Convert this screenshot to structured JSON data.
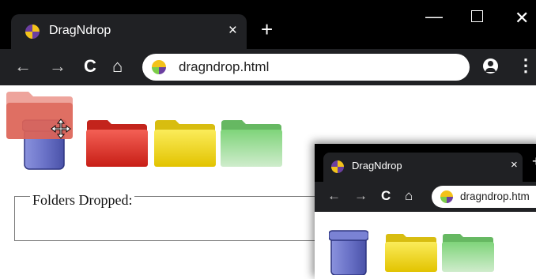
{
  "main_window": {
    "tab_title": "DragNdrop",
    "tab_close": "×",
    "new_tab": "+",
    "controls": {
      "minimize": "—",
      "close": "✕"
    },
    "toolbar": {
      "back": "←",
      "forward": "→",
      "reload": "C",
      "home": "⌂",
      "menu": "⋮"
    },
    "address": "dragndrop.html",
    "page": {
      "items": [
        {
          "name": "trash-bin",
          "color": "#6b73c8"
        },
        {
          "name": "folder-red",
          "color": "#e5372d"
        },
        {
          "name": "folder-yellow",
          "color": "#f2dc1b"
        },
        {
          "name": "folder-green",
          "color": "#5bbb5a"
        }
      ],
      "dragging_folder_color": "#e8857b",
      "fieldset_legend": "Folders Dropped:"
    }
  },
  "secondary_window": {
    "tab_title": "DragNdrop",
    "tab_close": "×",
    "new_tab": "+",
    "toolbar": {
      "back": "←",
      "forward": "→",
      "reload": "C",
      "home": "⌂"
    },
    "address": "dragndrop.htm"
  }
}
